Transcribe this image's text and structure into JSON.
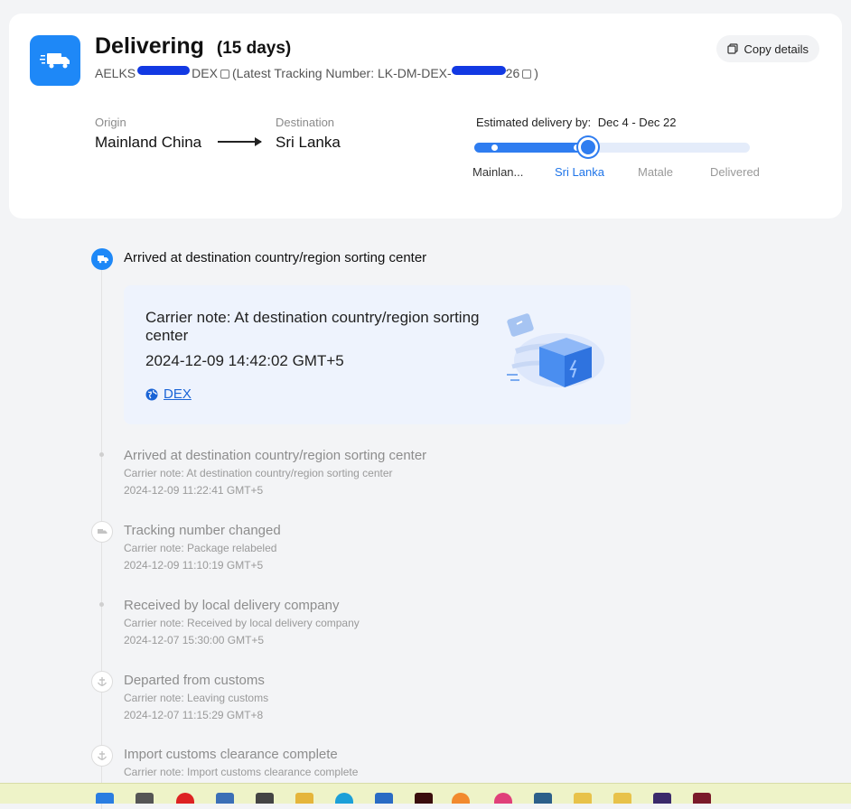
{
  "header": {
    "status": "Delivering",
    "duration": "(15 days)",
    "tracking_prefix": "AELKS",
    "tracking_suffix": "DEX",
    "latest_label": "(Latest Tracking Number: LK-DM-DEX-",
    "latest_end": "26",
    "latest_close": ")",
    "copy_label": "Copy details",
    "truck_icon": "truck-icon"
  },
  "route": {
    "origin_label": "Origin",
    "origin": "Mainland China",
    "destination_label": "Destination",
    "destination": "Sri Lanka",
    "eta_label": "Estimated delivery by:",
    "eta_range": "Dec 4 - Dec 22",
    "progress_fraction": 0.42,
    "stages": [
      "Mainlan...",
      "Sri Lanka",
      "Matale",
      "Delivered"
    ],
    "accent": "#2f7df0"
  },
  "timeline": {
    "current": {
      "title": "Arrived at destination country/region sorting center",
      "note": "Carrier note: At destination country/region sorting center",
      "time": "2024-12-09 14:42:02 GMT+5",
      "carrier": "DEX"
    },
    "events": [
      {
        "title": "Arrived at destination country/region sorting center",
        "note": "Carrier note: At destination country/region sorting center",
        "time": "2024-12-09 11:22:41 GMT+5"
      },
      {
        "title": "Tracking number changed",
        "note": "Carrier note: Package relabeled",
        "time": "2024-12-09 11:10:19 GMT+5"
      },
      {
        "title": "Received by local delivery company",
        "note": "Carrier note: Received by local delivery company",
        "time": "2024-12-07 15:30:00 GMT+5"
      },
      {
        "title": "Departed from customs",
        "note": "Carrier note: Leaving customs",
        "time": "2024-12-07 11:15:29 GMT+8"
      },
      {
        "title": "Import customs clearance complete",
        "note": "Carrier note: Import customs clearance complete",
        "time": ""
      }
    ]
  }
}
